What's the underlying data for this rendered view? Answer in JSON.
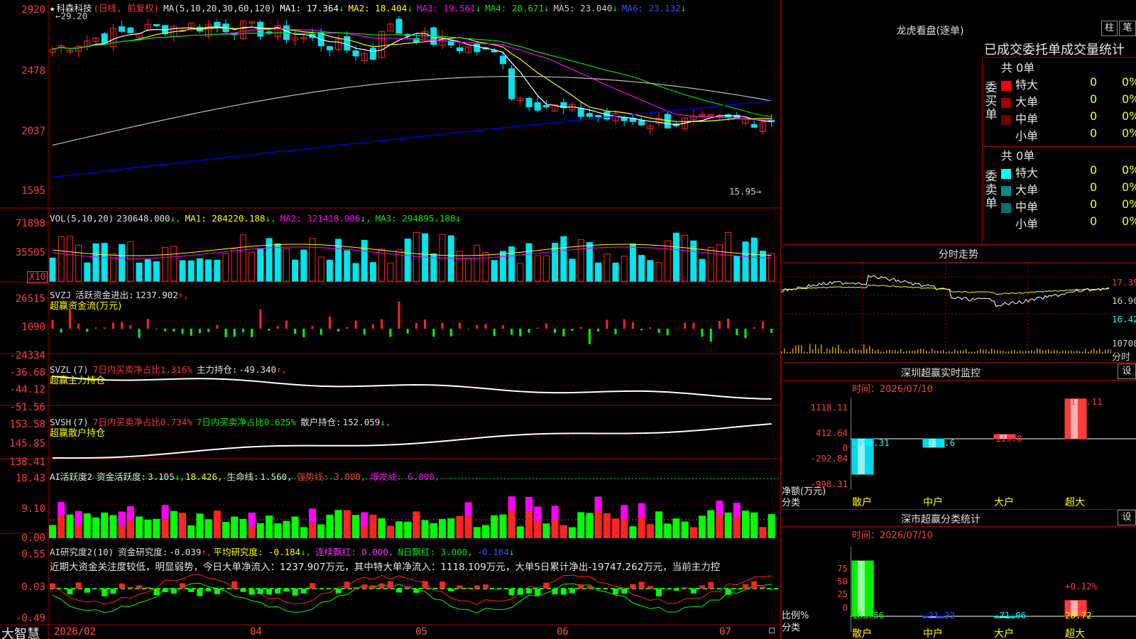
{
  "app": {
    "brand": "大智慧"
  },
  "colors": {
    "up": "#ff2424",
    "down": "#00e5ee",
    "ma1": "#ffffff",
    "ma2": "#ffff00",
    "ma3": "#ff00ff",
    "ma4": "#00e000",
    "ma5": "#c0c0c0",
    "ma6": "#0000ff",
    "grid": "#a00000",
    "green": "#00ff00",
    "magenta": "#ff00ff"
  },
  "kline": {
    "star": "★",
    "stock_name": "科森科技",
    "mode": "(日线, 前复权)",
    "ma_params": "MA(5,10,20,30,60,120)",
    "ma": [
      {
        "label": "MA1:",
        "value": "17.364"
      },
      {
        "label": "MA2:",
        "value": "18.404"
      },
      {
        "label": "MA3:",
        "value": "19.561"
      },
      {
        "label": "MA4:",
        "value": "20.671"
      },
      {
        "label": "MA5:",
        "value": "23.040"
      },
      {
        "label": "MA6:",
        "value": "23.132"
      }
    ],
    "arrow": "↓",
    "high_marker": "←29.20",
    "low_marker": "15.95→",
    "y_ticks": [
      "2920",
      "2478",
      "2037",
      "1595"
    ]
  },
  "vol": {
    "params": "VOL(5,10,20)",
    "value": "230648.000",
    "ma": [
      {
        "label": "MA1:",
        "value": "284220.188"
      },
      {
        "label": "MA2:",
        "value": "321418.906"
      },
      {
        "label": "MA3:",
        "value": "294895.188"
      }
    ],
    "y_ticks": [
      "71898",
      "35505"
    ],
    "unit": "X10"
  },
  "svzj": {
    "name": "SVZJ",
    "label1": "活跃资金进出:",
    "value1": "1237.902",
    "arrow": "↑,",
    "subtitle": "超赢资金流(万元)",
    "y_ticks": [
      "26515",
      "1090",
      "-24334"
    ]
  },
  "svzl": {
    "name": "SVZL",
    "param": "(7)",
    "label1": "7日内买卖净占比1.316%",
    "label2": "主力持仓:",
    "value2": "-49.340",
    "arrow": "↑,",
    "subtitle": "超赢主力持仓",
    "y_ticks": [
      "-36.68",
      "-44.12",
      "-51.56"
    ]
  },
  "svsh": {
    "name": "SVSH",
    "param": "(7)",
    "label1": "7日内买卖净占比0.734%",
    "label2": "7日内买卖净占比0.625%",
    "label3": "散户持仓:",
    "value3": "152.059",
    "arrow": "↓,",
    "subtitle": "超赢散户持仓",
    "y_ticks": [
      "153.58",
      "145.85",
      "138.41"
    ]
  },
  "ai2": {
    "name": "AI活跃度2",
    "l1": "资金活跃度:",
    "v1": "3.105",
    "a1": "↓,",
    "v2": "18.426",
    "l3": "生命线:",
    "v3": "1.560",
    "l4": "强势线:",
    "v4": "3.000",
    "l5": "爆发线:",
    "v5": "6.000",
    "comma": ",",
    "y_ticks": [
      "18.43",
      "9.10",
      "0.00"
    ]
  },
  "ai_research": {
    "name": "AI研究度2(10)",
    "l1": "资金研究度:",
    "v1": "-0.039",
    "a1": "↑,",
    "l2": "平均研究度:",
    "v2": "-0.184",
    "a2": "↓,",
    "l3": "连续飘红:",
    "v3": "0.000",
    "l4": "N日飘红:",
    "v4": "3.000",
    "v5": "-0.184",
    "a5": "↓",
    "comment": "近期大资金关注度较低，明显弱势，今日大单净流入：1237.907万元，其中特大单净流入：1118.109万元，大单5日累计净出-19747.262万元，当前主力控",
    "y_ticks": [
      "0.55",
      "0.03",
      "-0.49"
    ]
  },
  "months": [
    "2026/02",
    "04",
    "05",
    "06",
    "07"
  ],
  "right": {
    "dragon": {
      "title": "龙虎看盘(逐单)",
      "btn1": "柱",
      "btn2": "笔",
      "subtitle": "已成交委托单成交量统计",
      "buy": {
        "side": [
          "委",
          "买",
          "单"
        ],
        "total": "共 0单",
        "rows": [
          {
            "label": "特大",
            "v1": "0",
            "v2": "0%",
            "color": "#ff0000"
          },
          {
            "label": "大单",
            "v1": "0",
            "v2": "0%",
            "color": "#a00000"
          },
          {
            "label": "中单",
            "v1": "0",
            "v2": "0%",
            "color": "#700000"
          },
          {
            "label": "小单",
            "v1": "0",
            "v2": "0%",
            "color": ""
          }
        ]
      },
      "sell": {
        "side": [
          "委",
          "卖",
          "单"
        ],
        "total": "共 0单",
        "rows": [
          {
            "label": "特大",
            "v1": "0",
            "v2": "0%",
            "color": "#00ffff"
          },
          {
            "label": "大单",
            "v1": "0",
            "v2": "0%",
            "color": "#008c8c"
          },
          {
            "label": "中单",
            "v1": "0",
            "v2": "0%",
            "color": "#007070"
          },
          {
            "label": "小单",
            "v1": "0",
            "v2": "0%",
            "color": ""
          }
        ]
      }
    },
    "intraday": {
      "title": "分时走势",
      "ticks": [
        "17.39",
        "16.90",
        "16.42",
        "10708",
        "分时"
      ]
    },
    "sz_monitor": {
      "title": "深圳超赢实时监控",
      "btn": "设",
      "time_label": "时间：2026/07/10",
      "y_ticks": [
        "1118.11",
        "412.64",
        "0",
        "-292.84",
        "-998.31"
      ],
      "ylabel": "净额(万元)",
      "xlabel": "分类",
      "categories": [
        "散户",
        "中户",
        "大户",
        "超大"
      ],
      "values": [
        -998.31,
        -239.6,
        119.8,
        1118.11
      ],
      "value_labels": [
        "-998.31",
        "-239.6",
        "119.8",
        "1118.11"
      ]
    },
    "sz_class": {
      "title": "深市超赢分类统计",
      "btn": "设",
      "time_label": "时间：2026/07/10",
      "y_ticks": [
        "75",
        "50",
        "25",
        "0"
      ],
      "ylabel": "比例%",
      "xlabel": "分类",
      "categories": [
        "散户",
        "中户",
        "大户",
        "超大"
      ],
      "values": [
        163.56,
        -21.22,
        -71.06,
        28.72
      ],
      "value_labels": [
        "163.56",
        "-21.22",
        "-71.06",
        "28.72"
      ],
      "annotation": "+0.12%"
    }
  },
  "chart_data": [
    {
      "type": "bar",
      "title": "深圳超赢实时监控",
      "xlabel": "分类",
      "ylabel": "净额(万元)",
      "categories": [
        "散户",
        "中户",
        "大户",
        "超大"
      ],
      "values": [
        -998.31,
        -239.6,
        119.8,
        1118.11
      ],
      "ylim": [
        -998.31,
        1118.11
      ]
    },
    {
      "type": "bar",
      "title": "深市超赢分类统计",
      "xlabel": "分类",
      "ylabel": "比例%",
      "categories": [
        "散户",
        "中户",
        "大户",
        "超大"
      ],
      "values": [
        163.56,
        -21.22,
        -71.06,
        28.72
      ],
      "ylim": [
        0,
        75
      ]
    }
  ]
}
